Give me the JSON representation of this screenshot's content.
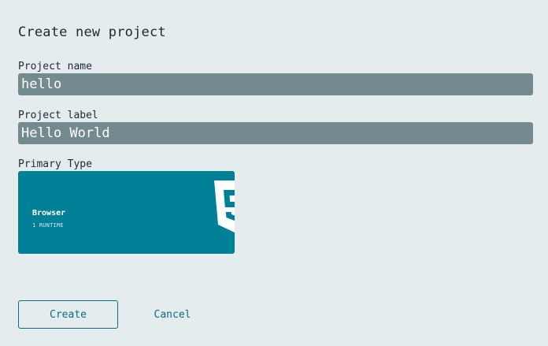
{
  "page": {
    "title": "Create new project"
  },
  "form": {
    "project_name": {
      "label": "Project name",
      "value": "hello"
    },
    "project_label": {
      "label": "Project label",
      "value": "Hello World"
    },
    "primary_type": {
      "label": "Primary Type",
      "card": {
        "title": "Browser",
        "subtitle": "1 RUNTIME",
        "icon": "html5-icon"
      }
    }
  },
  "actions": {
    "create_label": "Create",
    "cancel_label": "Cancel"
  },
  "colors": {
    "background": "#e4ecee",
    "field_background": "#738b8f",
    "card_background": "#008096",
    "accent": "#0a6d82"
  }
}
